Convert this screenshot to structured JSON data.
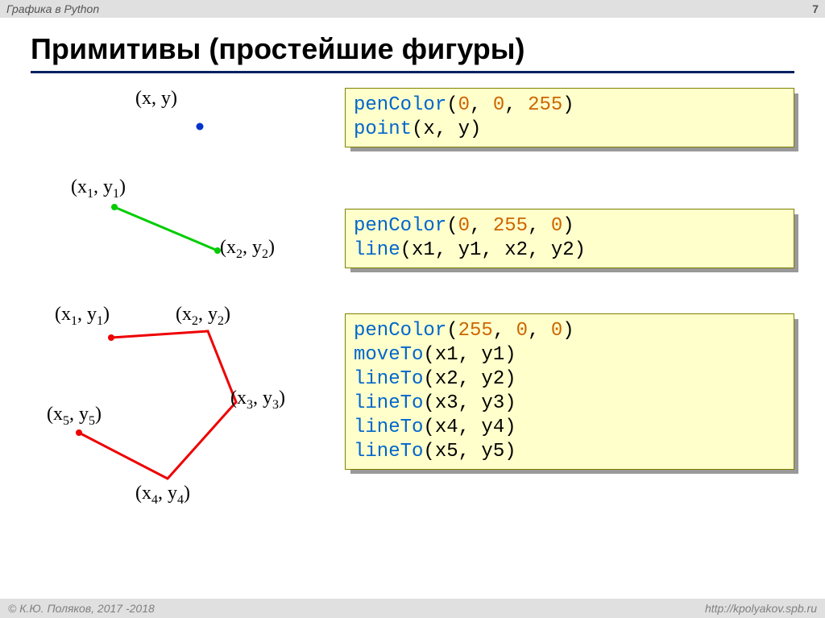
{
  "header": {
    "title": "Графика в Python",
    "page": "7"
  },
  "slide_title": "Примитивы (простейшие фигуры)",
  "labels": {
    "xy": "(x, y)",
    "x1y1": "(x",
    "x1y1_s1": "1",
    "x1y1_m": ", y",
    "x1y1_s2": "1",
    "x1y1_e": ")",
    "x2y2": "(x",
    "x2y2_s1": "2",
    "x2y2_m": ", y",
    "x2y2_s2": "2",
    "x2y2_e": ")",
    "x3y3": "(x",
    "x3y3_s1": "3",
    "x3y3_m": ", y",
    "x3y3_s2": "3",
    "x3y3_e": ")",
    "x4y4": "(x",
    "x4y4_s1": "4",
    "x4y4_m": ", y",
    "x4y4_s2": "4",
    "x4y4_e": ")",
    "x5y5": "(x",
    "x5y5_s1": "5",
    "x5y5_m": ", y",
    "x5y5_s2": "5",
    "x5y5_e": ")"
  },
  "code1": {
    "fn1": "penColor",
    "args1a": "(",
    "n1": "0",
    "c1": ", ",
    "n2": "0",
    "c2": ", ",
    "n3": "255",
    "args1b": ")",
    "fn2": "point",
    "args2": "(x, y)"
  },
  "code2": {
    "fn1": "penColor",
    "args1a": "(",
    "n1": "0",
    "c1": ", ",
    "n2": "255",
    "c2": ", ",
    "n3": "0",
    "args1b": ")",
    "fn2": "line",
    "args2": "(x1, y1, x2, y2)"
  },
  "code3": {
    "fn1": "penColor",
    "args1a": "(",
    "n1": "255",
    "c1": ", ",
    "n2": "0",
    "c2": ", ",
    "n3": "0",
    "args1b": ")",
    "fn2": "moveTo",
    "args2": "(x1, y1)",
    "fn3": "lineTo",
    "args3": "(x2, y2)",
    "fn4": "lineTo",
    "args4": "(x3, y3)",
    "fn5": "lineTo",
    "args5": "(x4, y4)",
    "fn6": "lineTo",
    "args6": "(x5, y5)"
  },
  "footer": {
    "left": "© К.Ю. Поляков, 2017 -2018",
    "right": "http://kpolyakov.spb.ru"
  }
}
